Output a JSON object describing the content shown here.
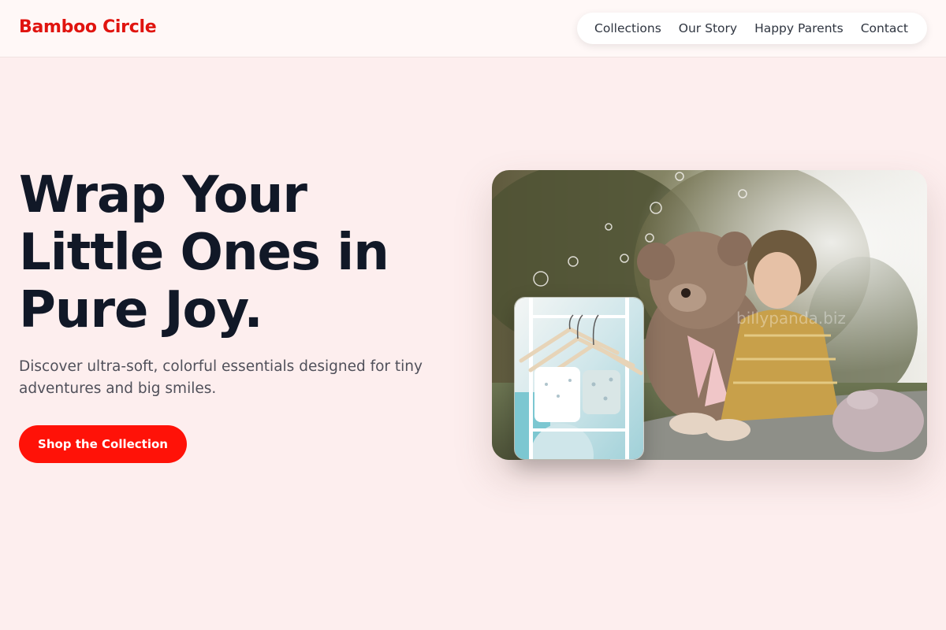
{
  "brand": {
    "name": "Bamboo Circle",
    "color": "#e0140f"
  },
  "nav": {
    "items": [
      {
        "label": "Collections"
      },
      {
        "label": "Our Story"
      },
      {
        "label": "Happy Parents"
      },
      {
        "label": "Contact"
      }
    ]
  },
  "hero": {
    "headline_lines": [
      "Wrap Your",
      "Little Ones in",
      "Pure Joy."
    ],
    "subtext": "Discover ultra-soft, colorful essentials designed for tiny adventures and big smiles.",
    "cta_label": "Shop the Collection",
    "cta_color": "#ff1208"
  },
  "images": {
    "main": {
      "subject": "baby-with-teddy-bear-photo",
      "watermark": "billypanda.biz"
    },
    "inset": {
      "subject": "baby-clothes-on-hangers-photo"
    }
  },
  "colors": {
    "page_background": "#fdeeee",
    "header_background": "#fff8f7",
    "headline": "#111827",
    "body_text": "#50505a"
  }
}
